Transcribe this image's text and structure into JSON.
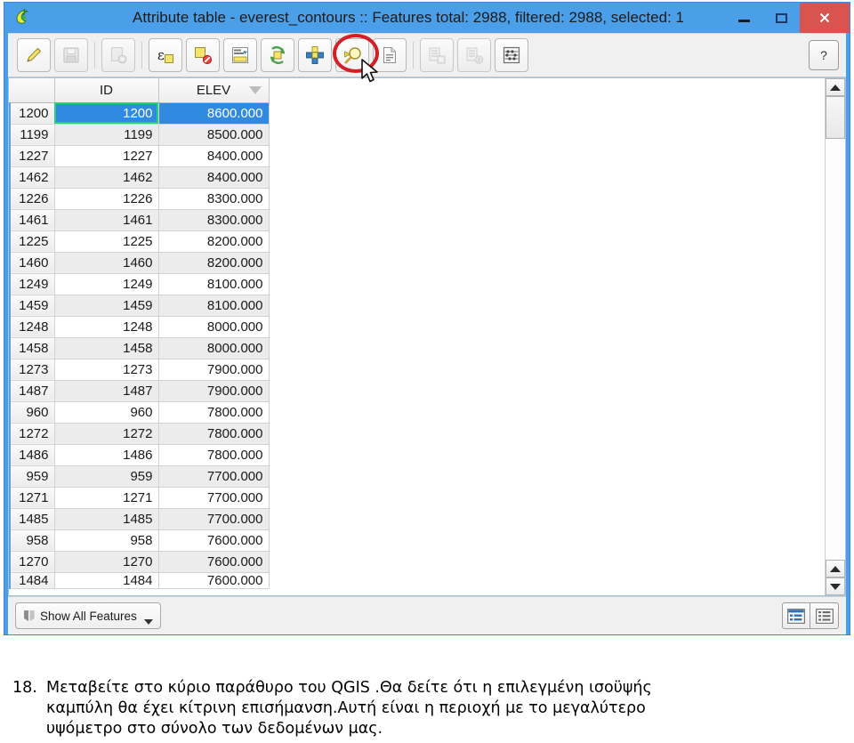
{
  "window": {
    "title": "Attribute table - everest_contours :: Features total: 2988, filtered: 2988, selected: 1",
    "app_icon": "qgis-logo-icon",
    "minimize_label": "–",
    "maximize_label": "□",
    "close_label": "✕"
  },
  "toolbar": {
    "help_label": "?",
    "buttons": [
      {
        "name": "toggle-editing-icon",
        "title": "Toggle editing mode",
        "enabled": true
      },
      {
        "name": "save-edits-icon",
        "title": "Save edits",
        "enabled": false
      },
      {
        "name": "delete-selected-icon",
        "title": "Delete selected features",
        "enabled": false
      },
      {
        "name": "field-calculator-icon",
        "title": "Open field calculator",
        "enabled": true
      },
      {
        "name": "deselect-all-icon",
        "title": "Deselect all",
        "enabled": true
      },
      {
        "name": "move-selection-to-top-icon",
        "title": "Move selection to top",
        "enabled": true
      },
      {
        "name": "invert-selection-icon",
        "title": "Invert selection",
        "enabled": true
      },
      {
        "name": "select-by-expression-icon",
        "title": "Select features using an expression",
        "enabled": true
      },
      {
        "name": "pan-map-to-selection-icon",
        "title": "Pan map to the selected rows",
        "enabled": true,
        "highlighted": true
      },
      {
        "name": "new-attribute-icon",
        "title": "New field",
        "enabled": true
      },
      {
        "name": "delete-attribute-icon",
        "title": "Delete field",
        "enabled": false
      },
      {
        "name": "organize-columns-icon",
        "title": "Organize columns",
        "enabled": false
      },
      {
        "name": "conditional-formatting-icon",
        "title": "Conditional formatting",
        "enabled": true
      }
    ]
  },
  "table": {
    "columns": [
      {
        "key": "rowid",
        "label": ""
      },
      {
        "key": "ID",
        "label": "ID"
      },
      {
        "key": "ELEV",
        "label": "ELEV",
        "sort": "descending"
      }
    ],
    "rows": [
      {
        "rowid": "1200",
        "ID": "1200",
        "ELEV": "8600.000",
        "selected": true
      },
      {
        "rowid": "1199",
        "ID": "1199",
        "ELEV": "8500.000"
      },
      {
        "rowid": "1227",
        "ID": "1227",
        "ELEV": "8400.000"
      },
      {
        "rowid": "1462",
        "ID": "1462",
        "ELEV": "8400.000"
      },
      {
        "rowid": "1226",
        "ID": "1226",
        "ELEV": "8300.000"
      },
      {
        "rowid": "1461",
        "ID": "1461",
        "ELEV": "8300.000"
      },
      {
        "rowid": "1225",
        "ID": "1225",
        "ELEV": "8200.000"
      },
      {
        "rowid": "1460",
        "ID": "1460",
        "ELEV": "8200.000"
      },
      {
        "rowid": "1249",
        "ID": "1249",
        "ELEV": "8100.000"
      },
      {
        "rowid": "1459",
        "ID": "1459",
        "ELEV": "8100.000"
      },
      {
        "rowid": "1248",
        "ID": "1248",
        "ELEV": "8000.000"
      },
      {
        "rowid": "1458",
        "ID": "1458",
        "ELEV": "8000.000"
      },
      {
        "rowid": "1273",
        "ID": "1273",
        "ELEV": "7900.000"
      },
      {
        "rowid": "1487",
        "ID": "1487",
        "ELEV": "7900.000"
      },
      {
        "rowid": "960",
        "ID": "960",
        "ELEV": "7800.000"
      },
      {
        "rowid": "1272",
        "ID": "1272",
        "ELEV": "7800.000"
      },
      {
        "rowid": "1486",
        "ID": "1486",
        "ELEV": "7800.000"
      },
      {
        "rowid": "959",
        "ID": "959",
        "ELEV": "7700.000"
      },
      {
        "rowid": "1271",
        "ID": "1271",
        "ELEV": "7700.000"
      },
      {
        "rowid": "1485",
        "ID": "1485",
        "ELEV": "7700.000"
      },
      {
        "rowid": "958",
        "ID": "958",
        "ELEV": "7600.000"
      },
      {
        "rowid": "1270",
        "ID": "1270",
        "ELEV": "7600.000"
      },
      {
        "rowid": "1484",
        "ID": "1484",
        "ELEV": "7600.000",
        "partial": true
      }
    ]
  },
  "statusbar": {
    "show_all_features_label": "Show All Features",
    "filter_icon": "filter-icon",
    "view_form_icon": "form-view-icon",
    "view_table_icon": "table-view-icon"
  },
  "annotation": {
    "ellipse_color": "#d41f26",
    "cursor": "mouse-pointer-icon"
  },
  "caption": {
    "number": "18.",
    "line1": "Μεταβείτε στο κύριο παράθυρο του QGIS .Θα δείτε ότι η επιλεγμένη ισοϋψής",
    "line2": "καμπύλη θα έχει κίτρινη επισήμανση.Αυτή είναι η περιοχή με το μεγαλύτερο",
    "line3": "υψόμετρο στο σύνολο των δεδομένων μας."
  },
  "colors": {
    "titlebar": "#4a9fe8",
    "close_button": "#d9534f",
    "selection_blue": "#2f8ae0",
    "focus_green": "#26d07c",
    "annotation_red": "#d41f26"
  }
}
